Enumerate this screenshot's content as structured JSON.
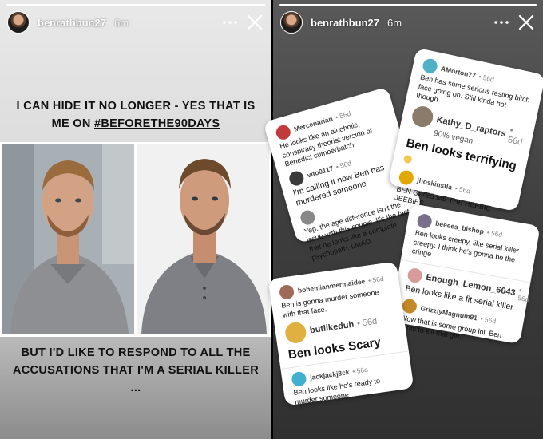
{
  "left_story": {
    "progress": 1.0,
    "username": "benrathbun27",
    "time": "6m",
    "caption_top_line1": "I CAN HIDE IT NO LONGER - YES THAT IS",
    "caption_top_line2_prefix": "ME ON ",
    "caption_top_hashtag": "#BEFORETHE90DAYS",
    "caption_bottom_line1": "BUT I'D LIKE TO RESPOND TO ALL THE",
    "caption_bottom_line2": "ACCUSATIONS THAT I'M A SERIAL KILLER ...",
    "more_icon": "ellipsis-icon",
    "close_icon": "close-icon"
  },
  "right_story": {
    "progress": 1.0,
    "username": "benrathbun27",
    "time": "6m",
    "more_icon": "ellipsis-icon",
    "close_icon": "close-icon",
    "cards": [
      {
        "comments": [
          {
            "user": "Mercenarian",
            "time": "56d",
            "text": "He looks like an alcoholic, conspiracy theorist version of Benedict cumberbatch",
            "avatar_color": "#c23b3b"
          },
          {
            "user": "vito0117",
            "time": "56d",
            "text": "I'm calling it now Ben has murdered someone",
            "avatar_color": "#3b3b3b"
          },
          {
            "user": "",
            "time": "",
            "text": "Yep, the age difference isn't the issue with this couple. It's the fact that he looks like a complete psychopath. LMAO",
            "avatar_color": "#888888"
          }
        ]
      },
      {
        "comments": [
          {
            "user": "AMorton77",
            "time": "56d",
            "text": "Ben has some serious resting bitch face going on. Still kinda hot though",
            "avatar_color": "#4fb0c6"
          },
          {
            "user": "Kathy_D_raptors",
            "time": "56d",
            "subtext": "90% vegan",
            "text": "Ben looks terrifying",
            "avatar_color": "#8a7b6a"
          },
          {
            "user": "jhoskinsfla",
            "time": "56d",
            "text": "BEN GIVES ME THE HEEBIE JEEBIES.",
            "avatar_color": "#e0a800"
          }
        ]
      },
      {
        "comments": [
          {
            "user": "beeees_bishop",
            "time": "56d",
            "text": "Ben looks creepy, like serial killer creepy. I think he's gonna be the cringe",
            "avatar_color": "#7a6f8a"
          },
          {
            "user": "Enough_Lemon_6043",
            "time": "56d",
            "text": "Ben looks like a fit serial killer",
            "avatar_color": "#d99a9a"
          },
          {
            "user": "GrizzlyMagnum91",
            "time": "56d",
            "text": "Wow that is some group lol. Ben bouts to kill that girl.",
            "avatar_color": "#c48a2a"
          }
        ]
      },
      {
        "comments": [
          {
            "user": "bohemianmermaidee",
            "time": "56d",
            "text": "Ben is gonna murder someone with that face.",
            "avatar_color": "#a06a5a"
          },
          {
            "user": "butlikeduh",
            "time": "56d",
            "text": "Ben looks Scary",
            "avatar_color": "#e0b040"
          },
          {
            "user": "jackjackj8ck",
            "time": "56d",
            "text": "Ben looks like he's ready to murder someone",
            "avatar_color": "#3fb0d0"
          }
        ]
      }
    ]
  }
}
